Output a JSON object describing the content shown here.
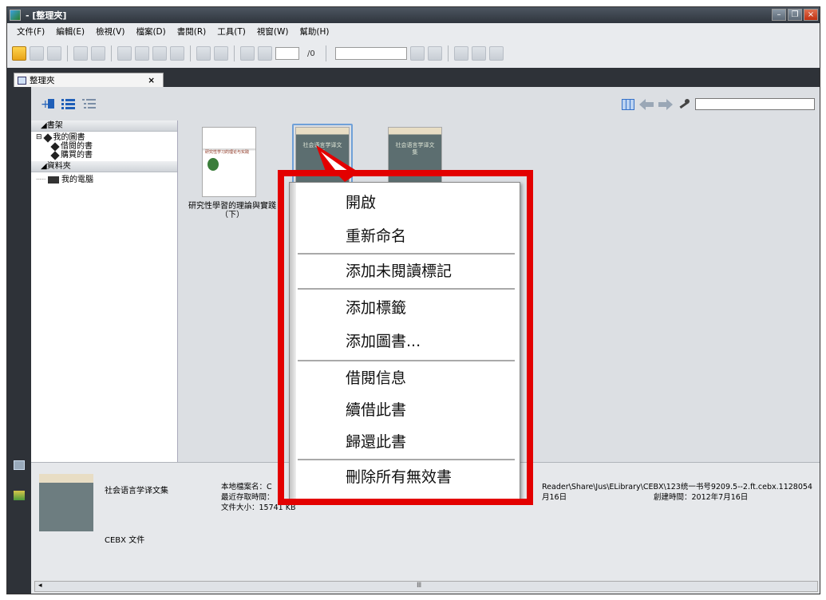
{
  "window": {
    "title": "- [整理夾]"
  },
  "menu": [
    "文件(F)",
    "編輯(E)",
    "檢視(V)",
    "檔案(D)",
    "書閱(R)",
    "工具(T)",
    "視窗(W)",
    "幫助(H)"
  ],
  "toolbar": {
    "page_total": "/0"
  },
  "tab": {
    "label": "整理夾",
    "close": "×"
  },
  "sidebar": {
    "bookshelf_header": "◢書架",
    "my_books": "我的圖書",
    "borrowed": "借閱的書",
    "purchased": "購買的書",
    "folders_header": "◢資料夾",
    "my_computer": "我的電腦"
  },
  "books": [
    {
      "title": "研究性學習的理論與實踐（下）",
      "cover_text": "研究性学习的理论与实践"
    },
    {
      "title": "社会语言学译文集",
      "cover_text": "社会语言学译文集"
    },
    {
      "title": "社会语言学译文集",
      "cover_text": "社会语言学译文集"
    }
  ],
  "context_menu": {
    "open": "開啟",
    "rename": "重新命名",
    "add_unread": "添加未閱讀標記",
    "add_tag": "添加標籤",
    "add_book": "添加圖書...",
    "borrow_info": "借閱信息",
    "renew": "續借此書",
    "return": "歸還此書",
    "delete_invalid": "刪除所有無效書"
  },
  "details": {
    "name": "社会语言学译文集",
    "type": "CEBX 文件",
    "local_filename": "本地檔案名：C",
    "last_access": "最近存取時間：",
    "size": "文件大小：15741 KB",
    "path_fragment": "Reader\\Share\\Jus\\ELibrary\\CEBX\\123统一书号9209.5--2.ft.cebx.1128054",
    "date_fragment": "月16日",
    "created": "創建時間：2012年7月16日",
    "scroll_mark": "Ⅲ"
  },
  "colors": {
    "highlight": "#e30000",
    "dark_chrome": "#2e3238"
  }
}
